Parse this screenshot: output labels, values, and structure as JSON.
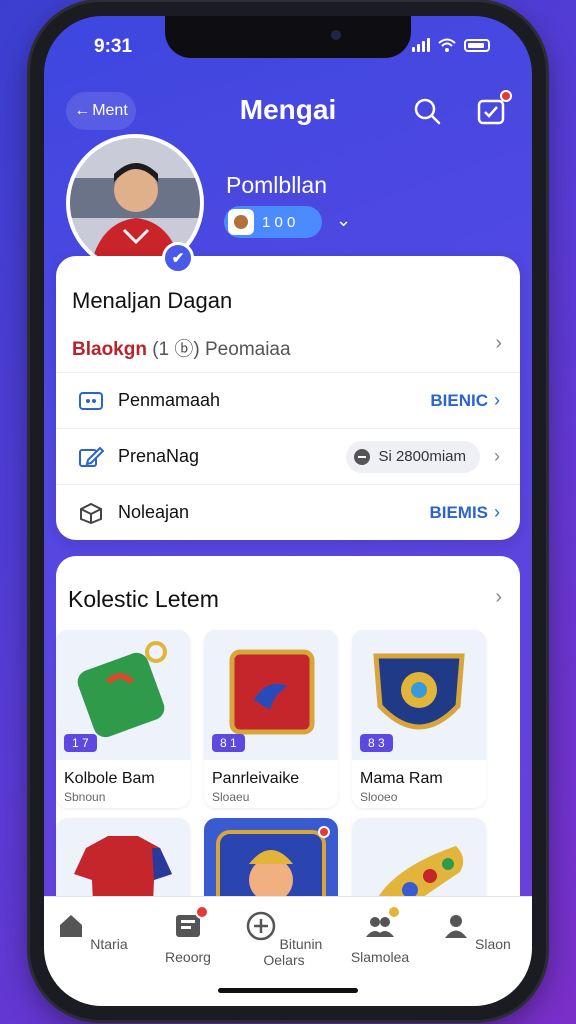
{
  "status": {
    "time": "9:31"
  },
  "header": {
    "back_label": "Ment",
    "title": "Mengai"
  },
  "profile": {
    "name": "Pomlbllan",
    "level": "1 0 0",
    "verified_mark": "✔"
  },
  "card": {
    "title": "Menaljan Dagan",
    "subtitle_red": "Blaokgn",
    "subtitle_rest": "(1 ⓑ) Peomaiaa",
    "rows": [
      {
        "label": "Penmamaah",
        "value": "BIENIC"
      },
      {
        "label": "PrenaNag",
        "value": "Si 2800miam"
      },
      {
        "label": "Noleajan",
        "value": "BIEMIS"
      }
    ]
  },
  "collection": {
    "title": "Kolestic Letem",
    "items": [
      {
        "name": "Kolbole Bam",
        "sub": "Sbnoun",
        "tag": "1 7",
        "icon": "green-bag-icon"
      },
      {
        "name": "Panrleivaike",
        "sub": "Sloaeu",
        "tag": "8 1",
        "icon": "red-cube-icon"
      },
      {
        "name": "Mama Ram",
        "sub": "Slooeo",
        "tag": "8 3",
        "icon": "shield-emblem-icon"
      },
      {
        "name": "",
        "sub": "",
        "tag": "",
        "icon": "red-jersey-icon"
      },
      {
        "name": "",
        "sub": "",
        "tag": "",
        "icon": "character-card-icon"
      },
      {
        "name": "",
        "sub": "",
        "tag": "",
        "icon": "golden-horn-icon"
      }
    ]
  },
  "tabs": [
    {
      "label": "Ntaria",
      "icon": "home-icon"
    },
    {
      "label": "Reoorg",
      "icon": "ticket-icon"
    },
    {
      "label": "Bitunin Oelars",
      "icon": "add-circle-icon"
    },
    {
      "label": "Slamolea",
      "icon": "users-icon"
    },
    {
      "label": "Slaon",
      "icon": "profile-icon"
    }
  ],
  "colors": {
    "accent": "#4a5ae8",
    "link": "#2a63d4",
    "badge": "#e53935"
  }
}
